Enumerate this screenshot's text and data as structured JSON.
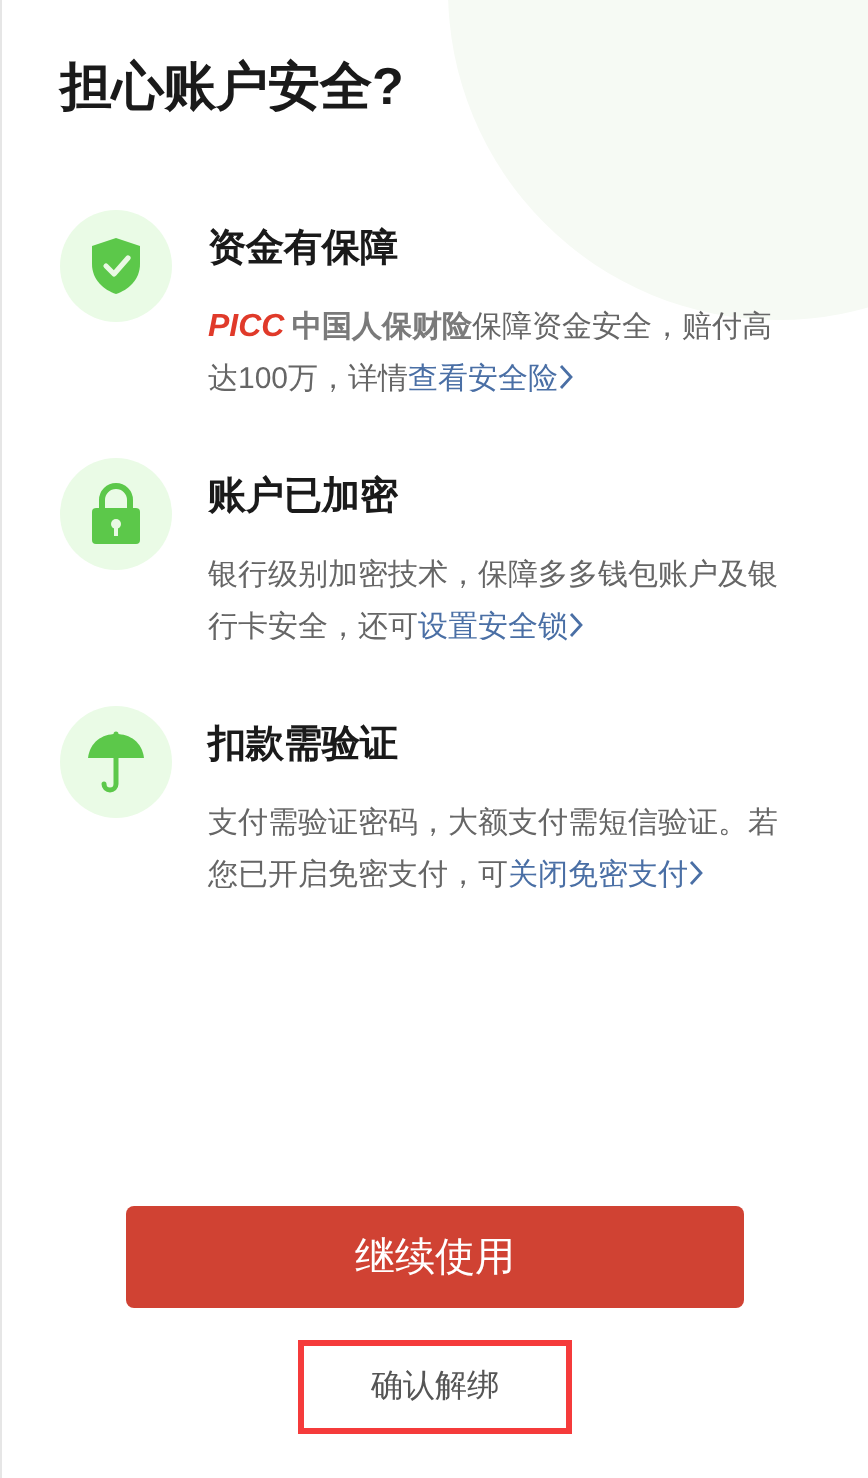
{
  "title": "担心账户安全?",
  "features": [
    {
      "kind": "shield",
      "title": "资金有保障",
      "description": [
        {
          "kind": "logo",
          "text": "PICC"
        },
        {
          "kind": "brand",
          "text": "中国人保财险"
        },
        {
          "kind": "text",
          "text": "保障资金安全，赔付高达100万，详情"
        },
        {
          "kind": "link",
          "text": "查看安全险"
        }
      ]
    },
    {
      "kind": "lock",
      "title": "账户已加密",
      "description": [
        {
          "kind": "text",
          "text": "银行级别加密技术，保障多多钱包账户及银行卡安全，还可"
        },
        {
          "kind": "link",
          "text": "设置安全锁"
        }
      ]
    },
    {
      "kind": "umbrella",
      "title": "扣款需验证",
      "description": [
        {
          "kind": "text",
          "text": "支付需验证密码，大额支付需短信验证。若您已开启免密支付，可"
        },
        {
          "kind": "link",
          "text": "关闭免密支付"
        }
      ]
    }
  ],
  "primary_button": {
    "label": "继续使用"
  },
  "secondary_button": {
    "label": "确认解绑",
    "highlighted": true
  }
}
